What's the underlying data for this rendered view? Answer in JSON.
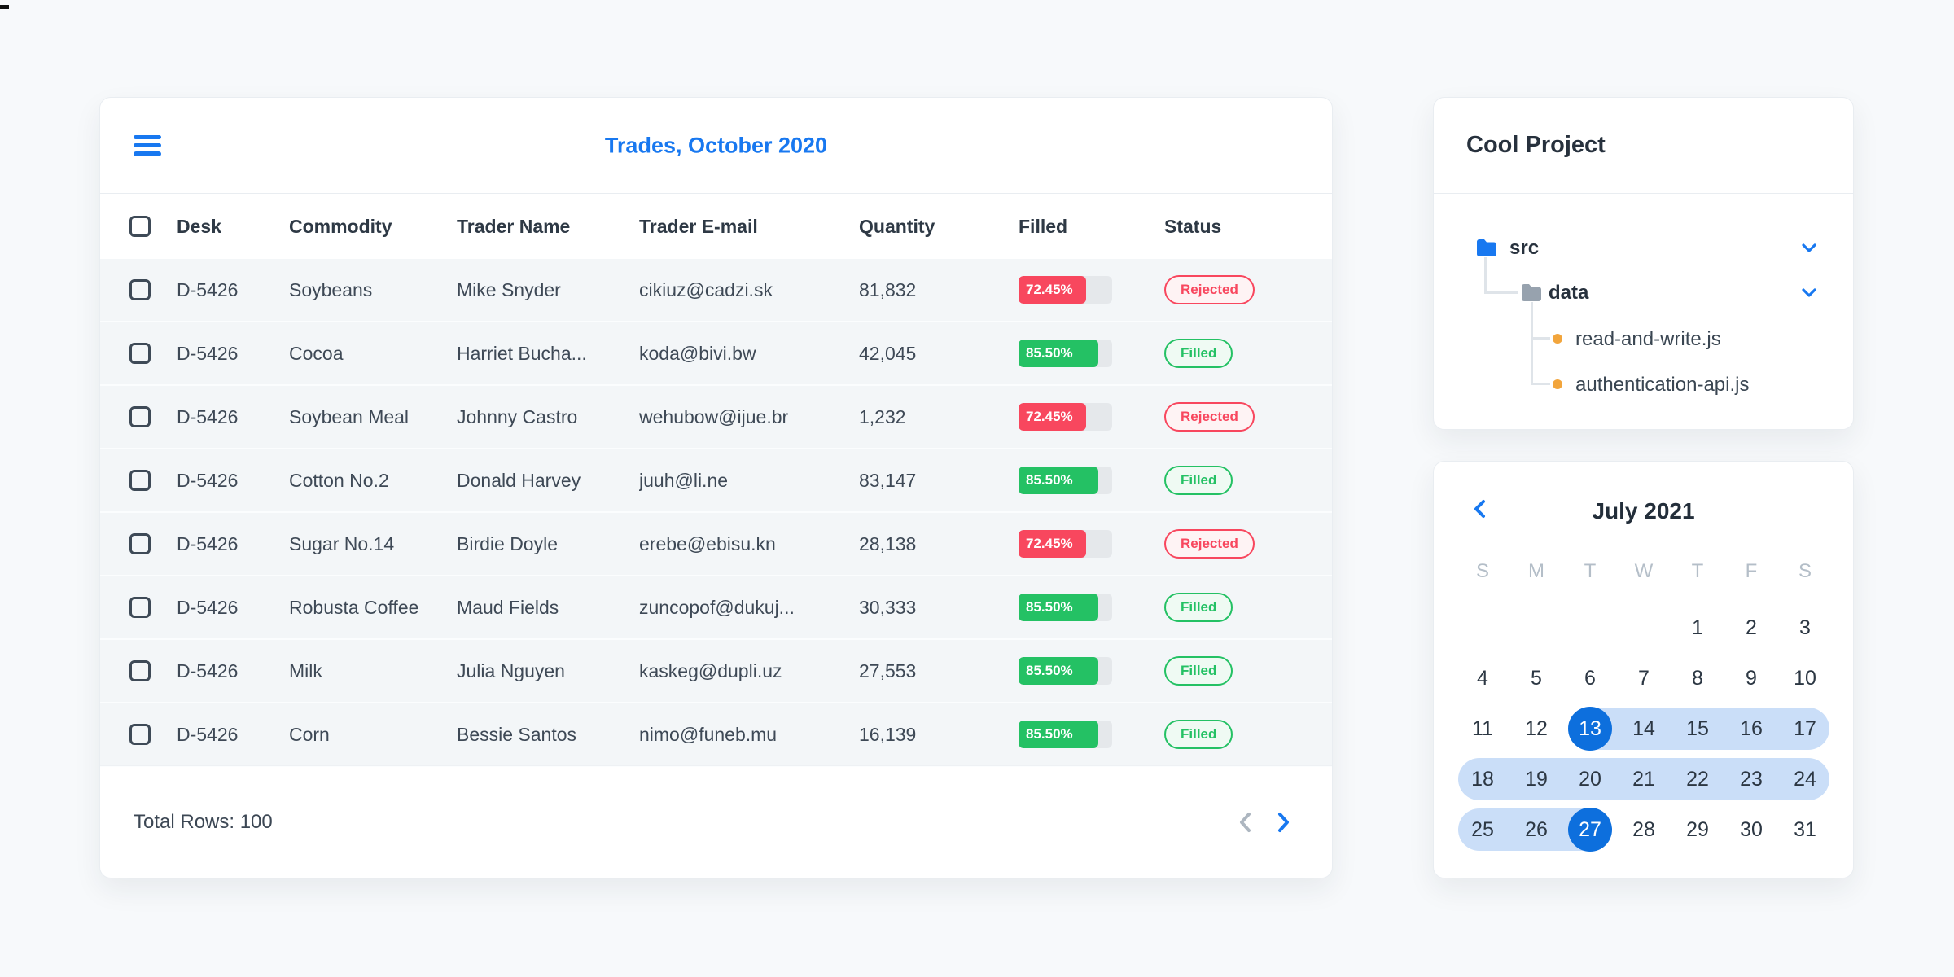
{
  "colors": {
    "accent_blue": "#1878f0",
    "selected_day_blue": "#0d6fdd",
    "range_blue": "#cadef8",
    "rejected_red": "#f8475e",
    "rejected_bg": "#fef3f4",
    "filled_green": "#24c164",
    "filled_bg": "#effaf3",
    "track_gray": "#e5e8eb",
    "page_bg": "#f7f9fb"
  },
  "trades_card": {
    "menu_icon": "hamburger-icon",
    "title": "Trades, October 2020",
    "columns": [
      "Desk",
      "Commodity",
      "Trader Name",
      "Trader E-mail",
      "Quantity",
      "Filled",
      "Status"
    ],
    "rows": [
      {
        "desk": "D-5426",
        "commodity": "Soybeans",
        "trader": "Mike Snyder",
        "email": "cikiuz@cadzi.sk",
        "quantity": "81,832",
        "filled_label": "72.45%",
        "filled_pct": 72.45,
        "status": "Rejected",
        "status_type": "rejected"
      },
      {
        "desk": "D-5426",
        "commodity": "Cocoa",
        "trader": "Harriet Bucha...",
        "email": "koda@bivi.bw",
        "quantity": "42,045",
        "filled_label": "85.50%",
        "filled_pct": 85.5,
        "status": "Filled",
        "status_type": "filled"
      },
      {
        "desk": "D-5426",
        "commodity": "Soybean Meal",
        "trader": "Johnny Castro",
        "email": "wehubow@ijue.br",
        "quantity": "1,232",
        "filled_label": "72.45%",
        "filled_pct": 72.45,
        "status": "Rejected",
        "status_type": "rejected"
      },
      {
        "desk": "D-5426",
        "commodity": "Cotton No.2",
        "trader": "Donald Harvey",
        "email": "juuh@li.ne",
        "quantity": "83,147",
        "filled_label": "85.50%",
        "filled_pct": 85.5,
        "status": "Filled",
        "status_type": "filled"
      },
      {
        "desk": "D-5426",
        "commodity": "Sugar No.14",
        "trader": "Birdie Doyle",
        "email": "erebe@ebisu.kn",
        "quantity": "28,138",
        "filled_label": "72.45%",
        "filled_pct": 72.45,
        "status": "Rejected",
        "status_type": "rejected"
      },
      {
        "desk": "D-5426",
        "commodity": "Robusta Coffee",
        "trader": "Maud Fields",
        "email": "zuncopof@dukuj...",
        "quantity": "30,333",
        "filled_label": "85.50%",
        "filled_pct": 85.5,
        "status": "Filled",
        "status_type": "filled"
      },
      {
        "desk": "D-5426",
        "commodity": "Milk",
        "trader": "Julia Nguyen",
        "email": "kaskeg@dupli.uz",
        "quantity": "27,553",
        "filled_label": "85.50%",
        "filled_pct": 85.5,
        "status": "Filled",
        "status_type": "filled"
      },
      {
        "desk": "D-5426",
        "commodity": "Corn",
        "trader": "Bessie Santos",
        "email": "nimo@funeb.mu",
        "quantity": "16,139",
        "filled_label": "85.50%",
        "filled_pct": 85.5,
        "status": "Filled",
        "status_type": "filled"
      }
    ],
    "footer": {
      "total": "Total Rows: 100",
      "prev_icon": "chevron-left-icon",
      "next_icon": "chevron-right-icon"
    }
  },
  "project_card": {
    "title": "Cool Project",
    "tree": {
      "src_label": "src",
      "data_label": "data",
      "file1_label": "read-and-write.js",
      "file2_label": "authentication-api.js"
    }
  },
  "calendar_card": {
    "title": "July 2021",
    "prev_icon": "chevron-left-icon",
    "day_headers": [
      "S",
      "M",
      "T",
      "W",
      "T",
      "F",
      "S"
    ],
    "selected_range": {
      "start": "13",
      "end": "27"
    },
    "weeks": [
      [
        {
          "d": ""
        },
        {
          "d": ""
        },
        {
          "d": ""
        },
        {
          "d": ""
        },
        {
          "d": "1"
        },
        {
          "d": "2"
        },
        {
          "d": "3"
        }
      ],
      [
        {
          "d": "4"
        },
        {
          "d": "5"
        },
        {
          "d": "6"
        },
        {
          "d": "7"
        },
        {
          "d": "8"
        },
        {
          "d": "9"
        },
        {
          "d": "10"
        }
      ],
      [
        {
          "d": "11"
        },
        {
          "d": "12"
        },
        {
          "d": "13",
          "state": "start"
        },
        {
          "d": "14",
          "state": "range"
        },
        {
          "d": "15",
          "state": "range"
        },
        {
          "d": "16",
          "state": "range"
        },
        {
          "d": "17",
          "state": "range",
          "cap": "right"
        }
      ],
      [
        {
          "d": "18",
          "state": "range",
          "cap": "left"
        },
        {
          "d": "19",
          "state": "range"
        },
        {
          "d": "20",
          "state": "range"
        },
        {
          "d": "21",
          "state": "range"
        },
        {
          "d": "22",
          "state": "range"
        },
        {
          "d": "23",
          "state": "range"
        },
        {
          "d": "24",
          "state": "range",
          "cap": "right"
        }
      ],
      [
        {
          "d": "25",
          "state": "range",
          "cap": "left"
        },
        {
          "d": "26",
          "state": "range"
        },
        {
          "d": "27",
          "state": "end"
        },
        {
          "d": "28"
        },
        {
          "d": "29"
        },
        {
          "d": "30"
        },
        {
          "d": "31"
        }
      ]
    ]
  }
}
